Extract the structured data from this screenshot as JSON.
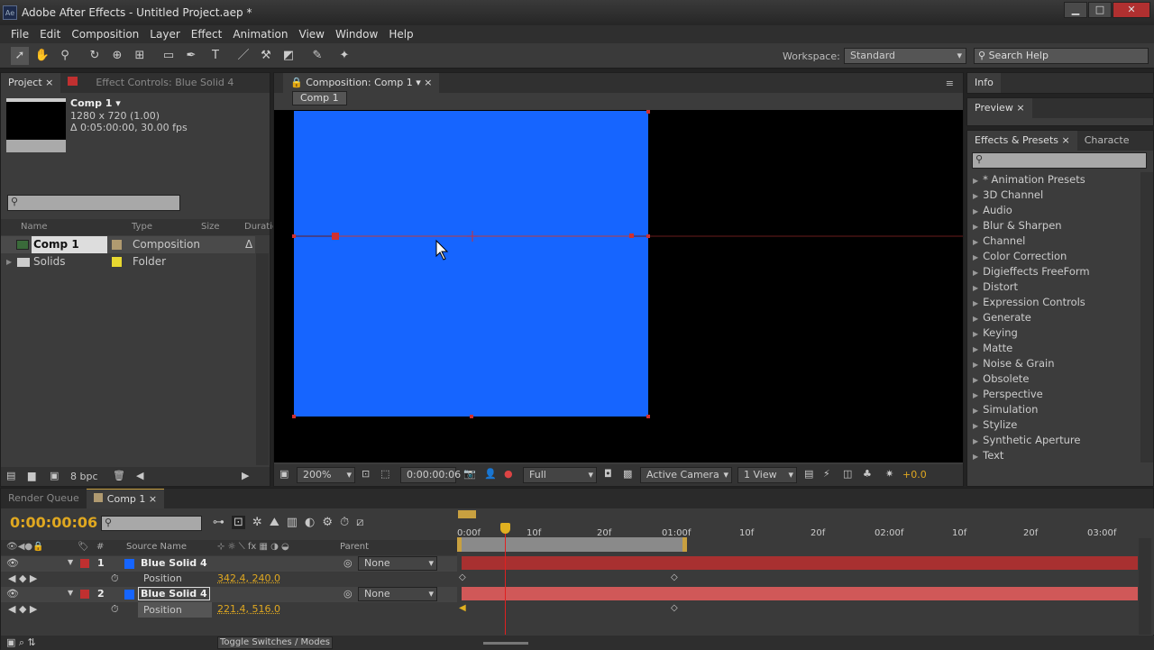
{
  "window": {
    "title": "Adobe After Effects - Untitled Project.aep *",
    "app_icon": "Ae",
    "min": "▁",
    "max": "□",
    "close": "✕"
  },
  "menu": [
    "File",
    "Edit",
    "Composition",
    "Layer",
    "Effect",
    "Animation",
    "View",
    "Window",
    "Help"
  ],
  "toolbar": {
    "workspace_label": "Workspace:",
    "workspace_value": "Standard",
    "search_placeholder": "Search Help"
  },
  "project": {
    "tab": "Project",
    "effect_tab": "Effect Controls: Blue Solid 4",
    "comp_name": "Comp 1 ▾",
    "comp_size": "1280 x 720 (1.00)",
    "comp_duration": "Δ 0:05:00:00, 30.00 fps",
    "columns": [
      "Name",
      "Type",
      "Size",
      "Duratio"
    ],
    "items": [
      {
        "name": "Comp 1",
        "type": "Composition",
        "color": "#b09a70",
        "dur": "Δ"
      },
      {
        "name": "Solids",
        "type": "Folder",
        "color": "#e8d830"
      }
    ],
    "bpc": "8 bpc"
  },
  "composition": {
    "tab": "Composition: Comp 1",
    "breadcrumb": "Comp 1",
    "solid_color": "#1665ff",
    "zoom": "200%",
    "timecode": "0:00:00:06",
    "resolution": "Full",
    "camera": "Active Camera",
    "views": "1 View",
    "exposure": "+0.0"
  },
  "right": {
    "info": "Info",
    "preview": "Preview",
    "effects_tab": "Effects & Presets",
    "char_tab": "Characte",
    "effects": [
      "* Animation Presets",
      "3D Channel",
      "Audio",
      "Blur & Sharpen",
      "Channel",
      "Color Correction",
      "Digieffects FreeForm",
      "Distort",
      "Expression Controls",
      "Generate",
      "Keying",
      "Matte",
      "Noise & Grain",
      "Obsolete",
      "Perspective",
      "Simulation",
      "Stylize",
      "Synthetic Aperture",
      "Text"
    ]
  },
  "timeline": {
    "render_tab": "Render Queue",
    "comp_tab": "Comp 1",
    "timecode": "0:00:00:06",
    "columns": {
      "num": "#",
      "source": "Source Name",
      "parent": "Parent"
    },
    "layers": [
      {
        "num": "1",
        "name": "Blue Solid 4",
        "parent": "None",
        "prop": "Position",
        "value": "342.4, 240.0"
      },
      {
        "num": "2",
        "name": "Blue Solid 4",
        "parent": "None",
        "prop": "Position",
        "value": "221.4, 516.0"
      }
    ],
    "ruler": [
      "0:00f",
      "10f",
      "20f",
      "01:00f",
      "10f",
      "20f",
      "02:00f",
      "10f",
      "20f",
      "03:00f"
    ],
    "toggle": "Toggle Switches / Modes"
  }
}
